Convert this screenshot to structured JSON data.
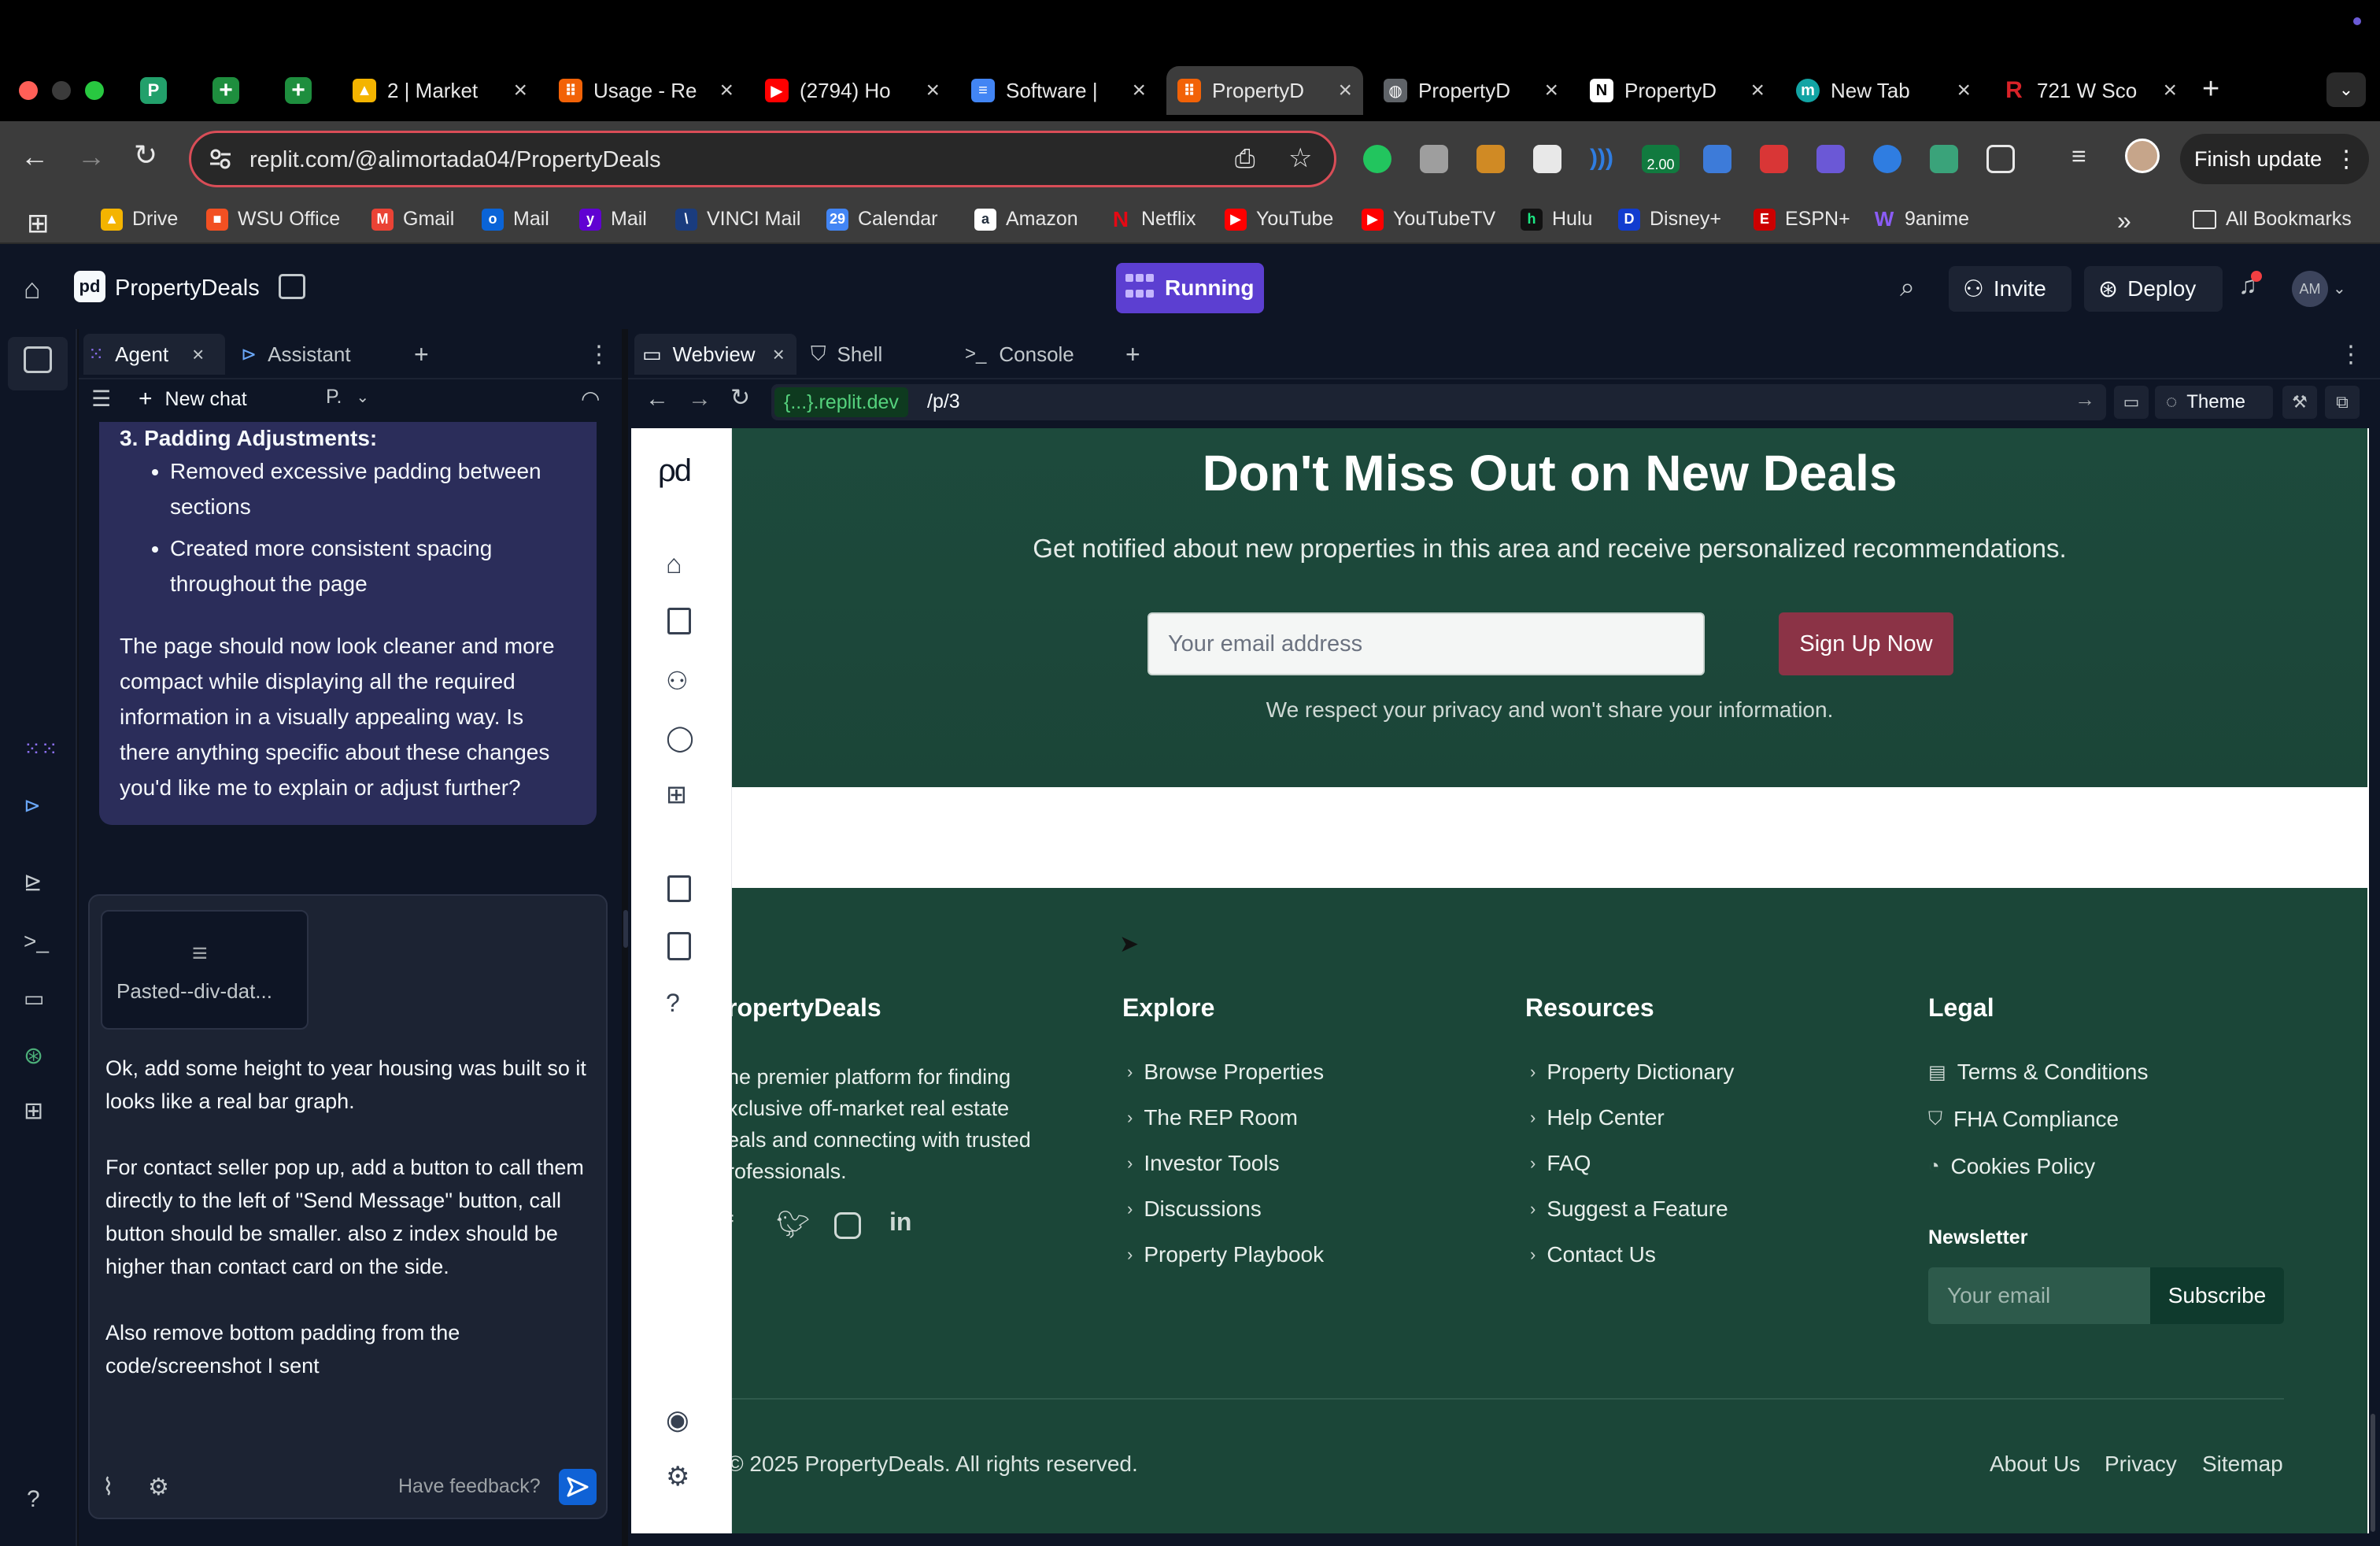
{
  "browser": {
    "tabs": [
      {
        "title": "",
        "color": "#22a06b",
        "glyph": "P"
      },
      {
        "title": "",
        "color": "#1e8e3e",
        "glyph": "+"
      },
      {
        "title": "",
        "color": "#1e8e3e",
        "glyph": "+"
      },
      {
        "title": "2 | Market",
        "color": "#f4b400",
        "glyph": "▲"
      },
      {
        "title": "Usage - Re",
        "color": "#f26207",
        "glyph": "⠿"
      },
      {
        "title": "(2794) Ho",
        "color": "#ff0000",
        "glyph": "▶"
      },
      {
        "title": "Software |",
        "color": "#4285f4",
        "glyph": "≡"
      },
      {
        "title": "PropertyD",
        "color": "#f26207",
        "glyph": "⠿"
      },
      {
        "title": "PropertyD",
        "color": "#5f6368",
        "glyph": "◍"
      },
      {
        "title": "PropertyD",
        "color": "#ffffff",
        "glyph": "N"
      },
      {
        "title": "New Tab",
        "color": "#12a4a4",
        "glyph": "m"
      },
      {
        "title": "721 W Sco",
        "color": "#d92228",
        "glyph": "R"
      }
    ],
    "url": "replit.com/@alimortada04/PropertyDeals",
    "finish_update": "Finish update",
    "extension_badge": "2.00",
    "bookmarks": [
      {
        "label": "Drive",
        "color": "#f4b400"
      },
      {
        "label": "WSU Office",
        "color": "#f25022"
      },
      {
        "label": "Gmail",
        "color": "#ea4335"
      },
      {
        "label": "Mail",
        "color": "#0a64d8"
      },
      {
        "label": "Mail",
        "color": "#6001d2"
      },
      {
        "label": "VINCI Mail",
        "color": "#1a3c7e"
      },
      {
        "label": "Calendar",
        "color": "#4285f4"
      },
      {
        "label": "Amazon",
        "color": "#232f3e"
      },
      {
        "label": "Netflix",
        "color": "#e50914"
      },
      {
        "label": "YouTube",
        "color": "#ff0000"
      },
      {
        "label": "YouTubeTV",
        "color": "#ff0000"
      },
      {
        "label": "Hulu",
        "color": "#1ce783"
      },
      {
        "label": "Disney+",
        "color": "#113ccf"
      },
      {
        "label": "ESPN+",
        "color": "#cc0000"
      },
      {
        "label": "9anime",
        "color": "#8b5cf6"
      }
    ],
    "all_bookmarks": "All Bookmarks"
  },
  "replit": {
    "project_name": "PropertyDeals",
    "status": "Running",
    "invite": "Invite",
    "deploy": "Deploy",
    "avatar": "AM",
    "left_tabs": [
      "Agent",
      "Assistant"
    ],
    "new_chat": "New chat",
    "model_selector": "P.",
    "right_tabs": [
      "Webview",
      "Shell",
      "Console"
    ],
    "webview_host": "{...}.replit.dev",
    "webview_path": "/p/3",
    "theme": "Theme",
    "accent": "#5c3fd1"
  },
  "chat": {
    "heading": "3. Padding Adjustments:",
    "bullets": [
      "Removed excessive padding between sections",
      "Created more consistent spacing throughout the page"
    ],
    "summary": "The page should now look cleaner and more compact while displaying all the required information in a visually appealing way. Is there anything specific about these changes you'd like me to explain or adjust further?",
    "attachment_name": "Pasted--div-dat...",
    "draft_paragraphs": [
      "Ok, add some height to year housing was built so it looks like a real bar graph.",
      "For contact seller pop up, add a button to call them directly to the left of \"Send Message\" button, call button should be smaller. also z index should be higher than contact card on the side.",
      "Also remove bottom padding from the code/screenshot I sent"
    ],
    "feedback": "Have feedback?"
  },
  "site": {
    "cta": {
      "title": "Don't Miss Out on New Deals",
      "subtitle": "Get notified about new properties in this area and receive personalized recommendations.",
      "email_placeholder": "Your email address",
      "signup": "Sign Up Now",
      "privacy_note": "We respect your privacy and won't share your information."
    },
    "footer": {
      "brand": "ropertyDeals",
      "description": [
        "he premier platform for finding",
        "xclusive off-market real estate",
        "eals and connecting with trusted",
        "rofessionals."
      ],
      "explore_title": "Explore",
      "explore": [
        "Browse Properties",
        "The REP Room",
        "Investor Tools",
        "Discussions",
        "Property Playbook"
      ],
      "resources_title": "Resources",
      "resources": [
        "Property Dictionary",
        "Help Center",
        "FAQ",
        "Suggest a Feature",
        "Contact Us"
      ],
      "legal_title": "Legal",
      "legal": [
        "Terms & Conditions",
        "FHA Compliance",
        "Cookies Policy"
      ],
      "newsletter_title": "Newsletter",
      "newsletter_placeholder": "Your email",
      "subscribe": "Subscribe",
      "copyright": "© 2025 PropertyDeals. All rights reserved.",
      "bottom_links": [
        "About Us",
        "Privacy",
        "Sitemap"
      ]
    },
    "colors": {
      "green": "#1b4638",
      "signup": "#8b3346",
      "subscribe": "#0f3a2d"
    }
  }
}
